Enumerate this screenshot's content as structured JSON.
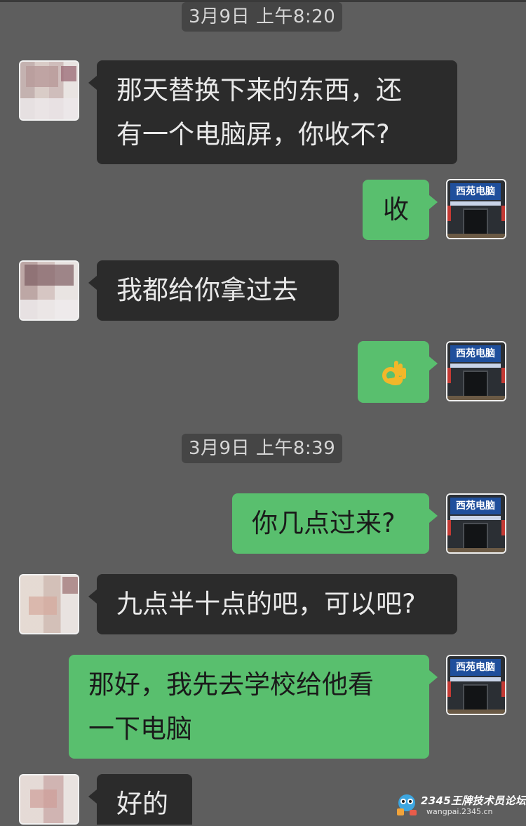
{
  "chat": {
    "timestamps": [
      "3月9日 上午8:20",
      "3月9日 上午8:39"
    ],
    "store_avatar_label": "西苑电脑",
    "messages": [
      {
        "sender": "contact",
        "lines": [
          "那天替换下来的东西，还",
          "有一个电脑屏，你收不?"
        ]
      },
      {
        "sender": "me",
        "lines": [
          "收"
        ]
      },
      {
        "sender": "contact",
        "lines": [
          "我都给你拿过去"
        ]
      },
      {
        "sender": "me",
        "emoji": "ok-hand-emoji"
      },
      {
        "sender": "me",
        "lines": [
          "你几点过来?"
        ]
      },
      {
        "sender": "contact",
        "lines": [
          "九点半十点的吧，可以吧?"
        ]
      },
      {
        "sender": "me",
        "lines": [
          "那好，我先去学校给他看",
          "一下电脑"
        ]
      },
      {
        "sender": "contact",
        "lines": [
          "好的"
        ]
      }
    ]
  },
  "watermark": {
    "title": "2345王牌技术员论坛",
    "url": "wangpai.2345.cn"
  },
  "colors": {
    "background": "#5e5e5e",
    "incoming_bubble": "#2b2b2b",
    "outgoing_bubble": "#59bf6e",
    "timestamp_bg": "#454545"
  }
}
